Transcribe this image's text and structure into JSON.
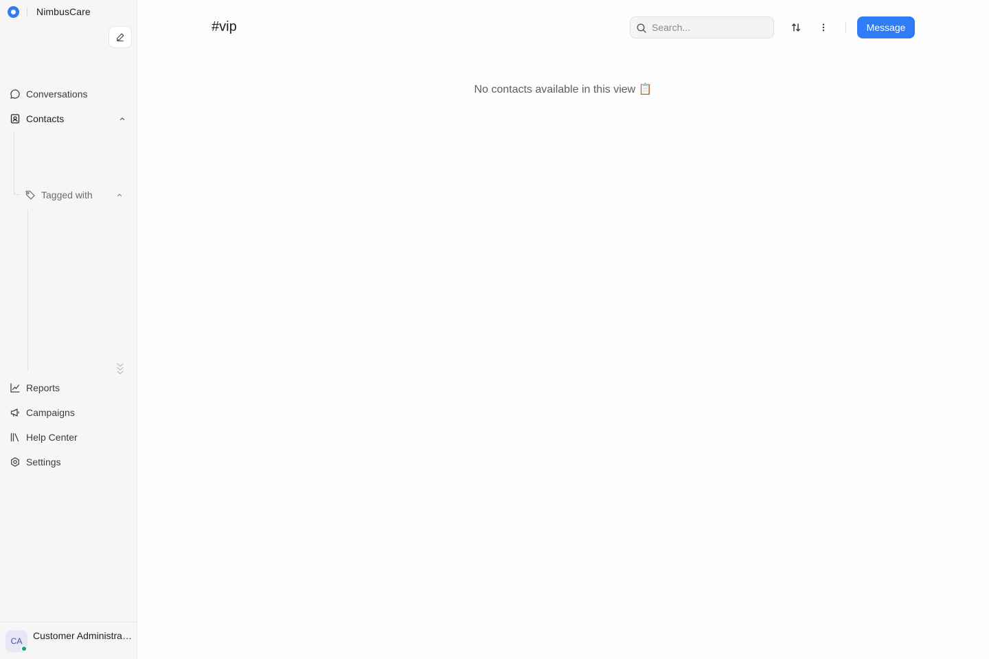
{
  "brand": {
    "name": "NimbusCare"
  },
  "sidebar": {
    "items": [
      {
        "label": "Conversations",
        "icon": "chat-bubble-icon"
      },
      {
        "label": "Contacts",
        "icon": "contact-book-icon"
      },
      {
        "label": "Reports",
        "icon": "line-chart-icon"
      },
      {
        "label": "Campaigns",
        "icon": "megaphone-icon"
      },
      {
        "label": "Help Center",
        "icon": "library-books-icon"
      },
      {
        "label": "Settings",
        "icon": "gear-icon"
      }
    ],
    "contacts_sub": {
      "label": "Tagged with",
      "icon": "tag-icon"
    }
  },
  "user": {
    "initials": "CA",
    "name": "Customer Administrator",
    "status_color": "#17a673"
  },
  "header": {
    "title": "#vip",
    "search_placeholder": "Search...",
    "message_label": "Message"
  },
  "empty_state": {
    "text": "No contacts available in this view",
    "emoji": "📋"
  },
  "colors": {
    "accent": "#2f7cf6"
  }
}
